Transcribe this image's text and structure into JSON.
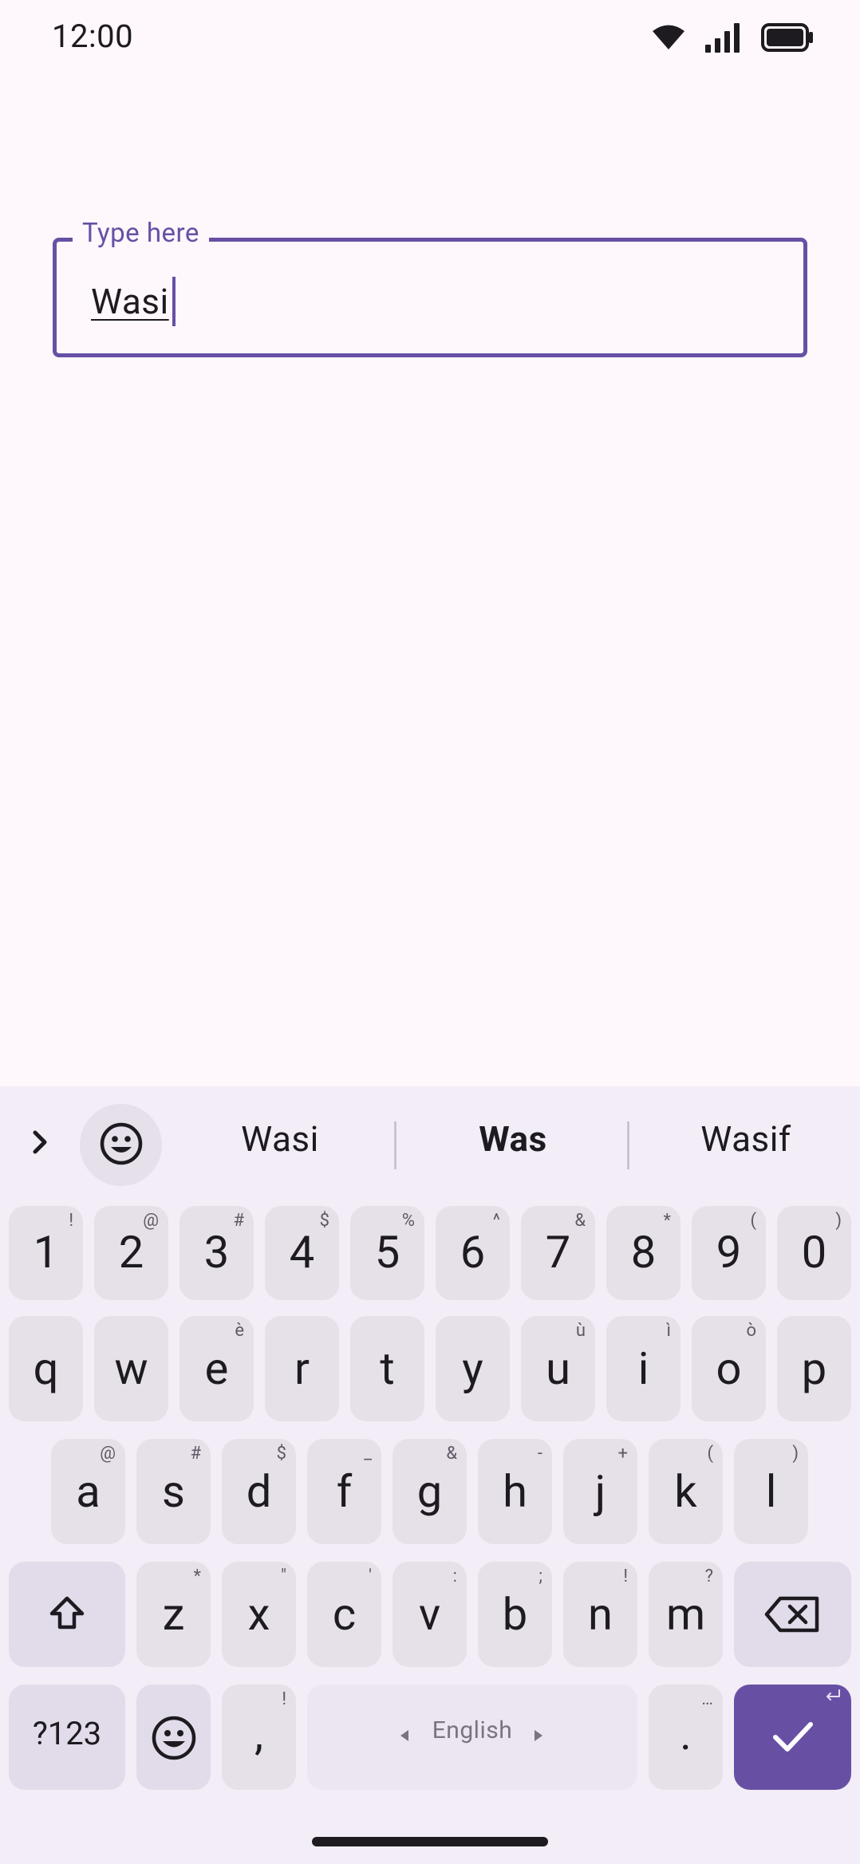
{
  "status_bar": {
    "time": "12:00",
    "icons": [
      "wifi-icon",
      "signal-icon",
      "battery-icon"
    ]
  },
  "text_field": {
    "label": "Type here",
    "value": "Wasi"
  },
  "keyboard": {
    "suggestions": [
      {
        "text": "Wasi",
        "bold": false
      },
      {
        "text": "Was",
        "bold": true
      },
      {
        "text": "Wasif",
        "bold": false
      }
    ],
    "number_row": [
      {
        "key": "1",
        "hint": "!"
      },
      {
        "key": "2",
        "hint": "@"
      },
      {
        "key": "3",
        "hint": "#"
      },
      {
        "key": "4",
        "hint": "$"
      },
      {
        "key": "5",
        "hint": "%"
      },
      {
        "key": "6",
        "hint": "^"
      },
      {
        "key": "7",
        "hint": "&"
      },
      {
        "key": "8",
        "hint": "*"
      },
      {
        "key": "9",
        "hint": "("
      },
      {
        "key": "0",
        "hint": ")"
      }
    ],
    "row_q": [
      {
        "key": "q",
        "hint": ""
      },
      {
        "key": "w",
        "hint": ""
      },
      {
        "key": "e",
        "hint": "è"
      },
      {
        "key": "r",
        "hint": ""
      },
      {
        "key": "t",
        "hint": ""
      },
      {
        "key": "y",
        "hint": ""
      },
      {
        "key": "u",
        "hint": "ù"
      },
      {
        "key": "i",
        "hint": "ì"
      },
      {
        "key": "o",
        "hint": "ò"
      },
      {
        "key": "p",
        "hint": ""
      }
    ],
    "row_a": [
      {
        "key": "a",
        "hint": "@"
      },
      {
        "key": "s",
        "hint": "#"
      },
      {
        "key": "d",
        "hint": "$"
      },
      {
        "key": "f",
        "hint": "_"
      },
      {
        "key": "g",
        "hint": "&"
      },
      {
        "key": "h",
        "hint": "-"
      },
      {
        "key": "j",
        "hint": "+"
      },
      {
        "key": "k",
        "hint": "("
      },
      {
        "key": "l",
        "hint": ")"
      }
    ],
    "row_z": [
      {
        "key": "z",
        "hint": "*"
      },
      {
        "key": "x",
        "hint": "\""
      },
      {
        "key": "c",
        "hint": "'"
      },
      {
        "key": "v",
        "hint": ":"
      },
      {
        "key": "b",
        "hint": ";"
      },
      {
        "key": "n",
        "hint": "!"
      },
      {
        "key": "m",
        "hint": "?"
      }
    ],
    "bottom_row": {
      "symbols_label": "?123",
      "comma": {
        "key": ",",
        "hint": "!"
      },
      "space_label": "English",
      "period": {
        "key": ".",
        "hint": "…"
      }
    },
    "colors": {
      "accent": "#6750a4",
      "key_bg": "#e6e0e9",
      "keyboard_bg": "#f3edf7"
    }
  }
}
